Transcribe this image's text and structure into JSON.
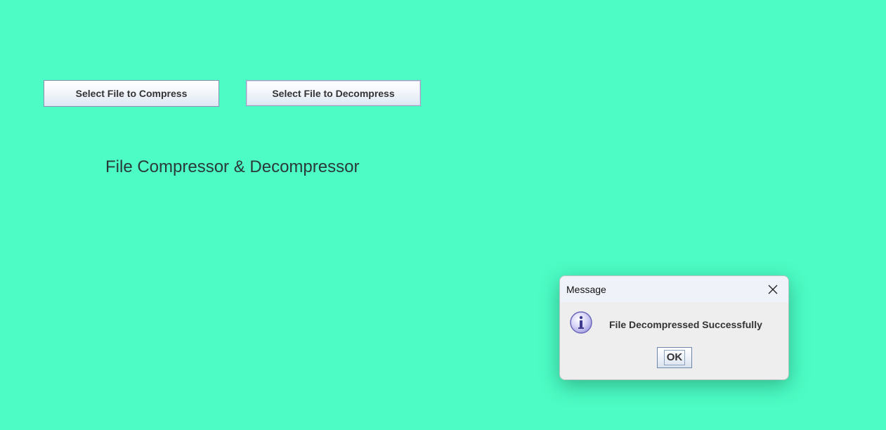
{
  "main": {
    "compress_button_label": "Select File to Compress",
    "decompress_button_label": "Select File to Decompress",
    "title": "File Compressor & Decompressor",
    "background_color": "#4cfcc4"
  },
  "dialog": {
    "title": "Message",
    "close_icon": "close-icon",
    "info_icon": "info-icon",
    "message": "File Decompressed Successfully",
    "ok_label": "OK"
  }
}
